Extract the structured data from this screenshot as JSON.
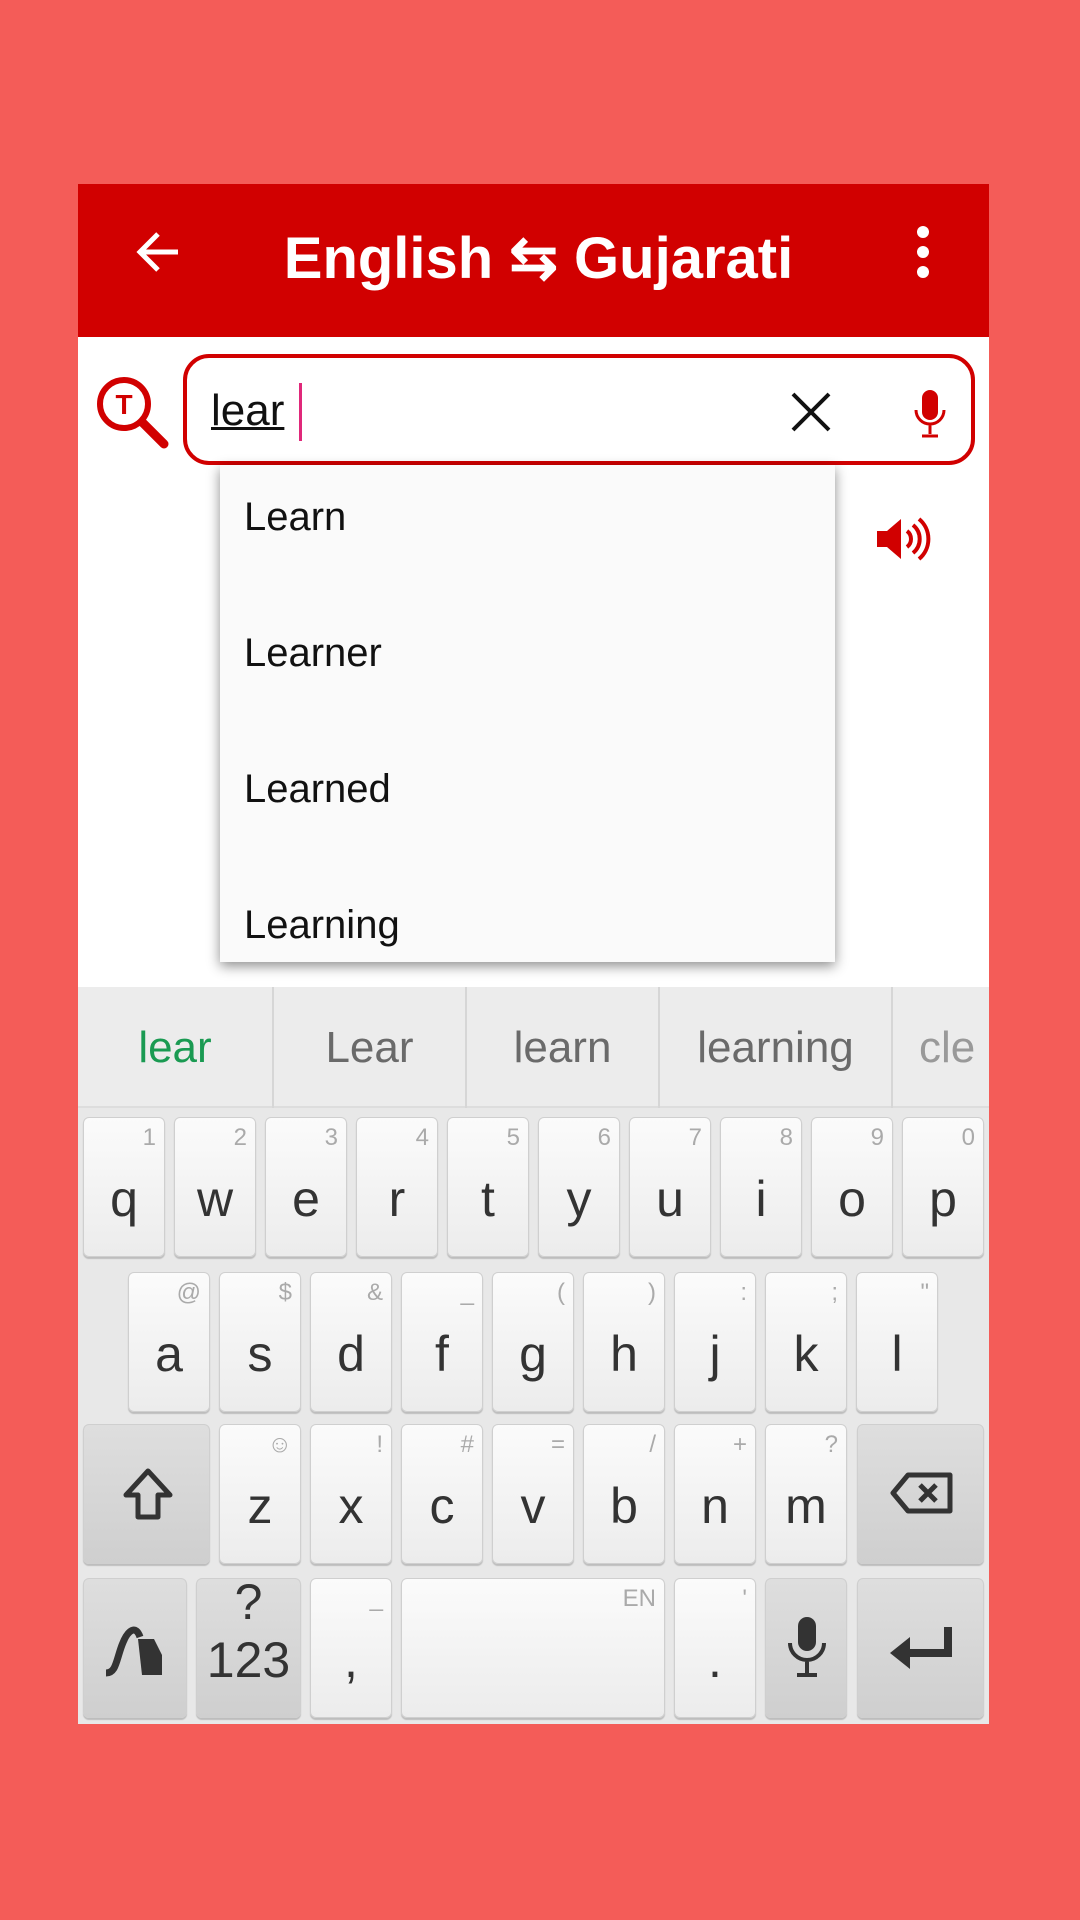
{
  "header": {
    "title": "English ⇆ Gujarati",
    "back_icon": "arrow-left-icon",
    "menu_icon": "more-vert-icon",
    "color": "#d10000"
  },
  "search": {
    "value": "lear",
    "clear_icon": "close-icon",
    "mic_icon": "mic-icon",
    "logo_icon": "translate-search-icon"
  },
  "speaker_icon": "speaker-icon",
  "dropdown": {
    "items": [
      "Learn",
      "Learner",
      "Learned",
      "Learning"
    ]
  },
  "keyboard": {
    "suggestions": [
      "lear",
      "Lear",
      "learn",
      "learning",
      "cle"
    ],
    "suggestion_accent": "#1a9a52",
    "row1": [
      [
        "q",
        "1"
      ],
      [
        "w",
        "2"
      ],
      [
        "e",
        "3"
      ],
      [
        "r",
        "4"
      ],
      [
        "t",
        "5"
      ],
      [
        "y",
        "6"
      ],
      [
        "u",
        "7"
      ],
      [
        "i",
        "8"
      ],
      [
        "o",
        "9"
      ],
      [
        "p",
        "0"
      ]
    ],
    "row2": [
      [
        "a",
        "@"
      ],
      [
        "s",
        "$"
      ],
      [
        "d",
        "&"
      ],
      [
        "f",
        "_"
      ],
      [
        "g",
        "("
      ],
      [
        "h",
        ")"
      ],
      [
        "j",
        ":"
      ],
      [
        "k",
        ";"
      ],
      [
        "l",
        "\""
      ]
    ],
    "row3": [
      [
        "z",
        "☺"
      ],
      [
        "x",
        "!"
      ],
      [
        "c",
        "#"
      ],
      [
        "v",
        "="
      ],
      [
        "b",
        "/"
      ],
      [
        "n",
        "+"
      ],
      [
        "m",
        "?"
      ]
    ],
    "symbols_label": "?123",
    "comma": [
      ",",
      "_"
    ],
    "space_hint": "EN",
    "period": [
      ".",
      "'"
    ]
  }
}
